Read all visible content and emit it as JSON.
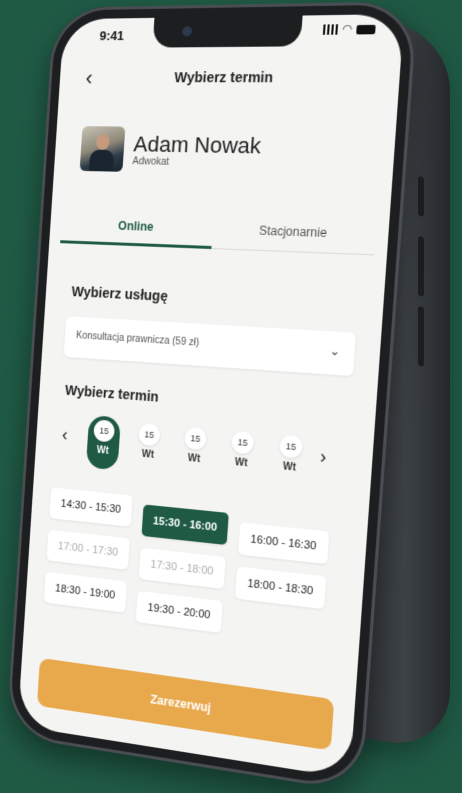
{
  "status": {
    "time": "9:41"
  },
  "header": {
    "title": "Wybierz termin"
  },
  "profile": {
    "name": "Adam Nowak",
    "role": "Adwokat"
  },
  "tabs": [
    {
      "label": "Online",
      "active": true
    },
    {
      "label": "Stacjonarnie",
      "active": false
    }
  ],
  "service": {
    "title": "Wybierz usługę",
    "selected": "Konsultacja prawnicza (59 zł)"
  },
  "term": {
    "title": "Wybierz termin"
  },
  "dates": [
    {
      "num": "15",
      "day": "Wt",
      "active": true
    },
    {
      "num": "15",
      "day": "Wt",
      "active": false
    },
    {
      "num": "15",
      "day": "Wt",
      "active": false
    },
    {
      "num": "15",
      "day": "Wt",
      "active": false
    },
    {
      "num": "15",
      "day": "Wt",
      "active": false
    }
  ],
  "slots": [
    {
      "label": "14:30 - 15:30",
      "state": "available"
    },
    {
      "label": "15:30 - 16:00",
      "state": "selected"
    },
    {
      "label": "16:00 - 16:30",
      "state": "available"
    },
    {
      "label": "17:00 - 17:30",
      "state": "unavailable"
    },
    {
      "label": "17:30 - 18:00",
      "state": "unavailable"
    },
    {
      "label": "18:00 - 18:30",
      "state": "available"
    },
    {
      "label": "18:30 - 19:00",
      "state": "available"
    },
    {
      "label": "19:30 - 20:00",
      "state": "available"
    }
  ],
  "reserve_label": "Zarezerwuj",
  "colors": {
    "brand": "#1f5a45",
    "accent": "#e8a84c",
    "background": "#1f5a45"
  },
  "icons": {
    "back": "chevron-left-icon",
    "select": "chevron-down-icon",
    "prev": "chevron-left-icon",
    "next": "chevron-right-icon"
  }
}
